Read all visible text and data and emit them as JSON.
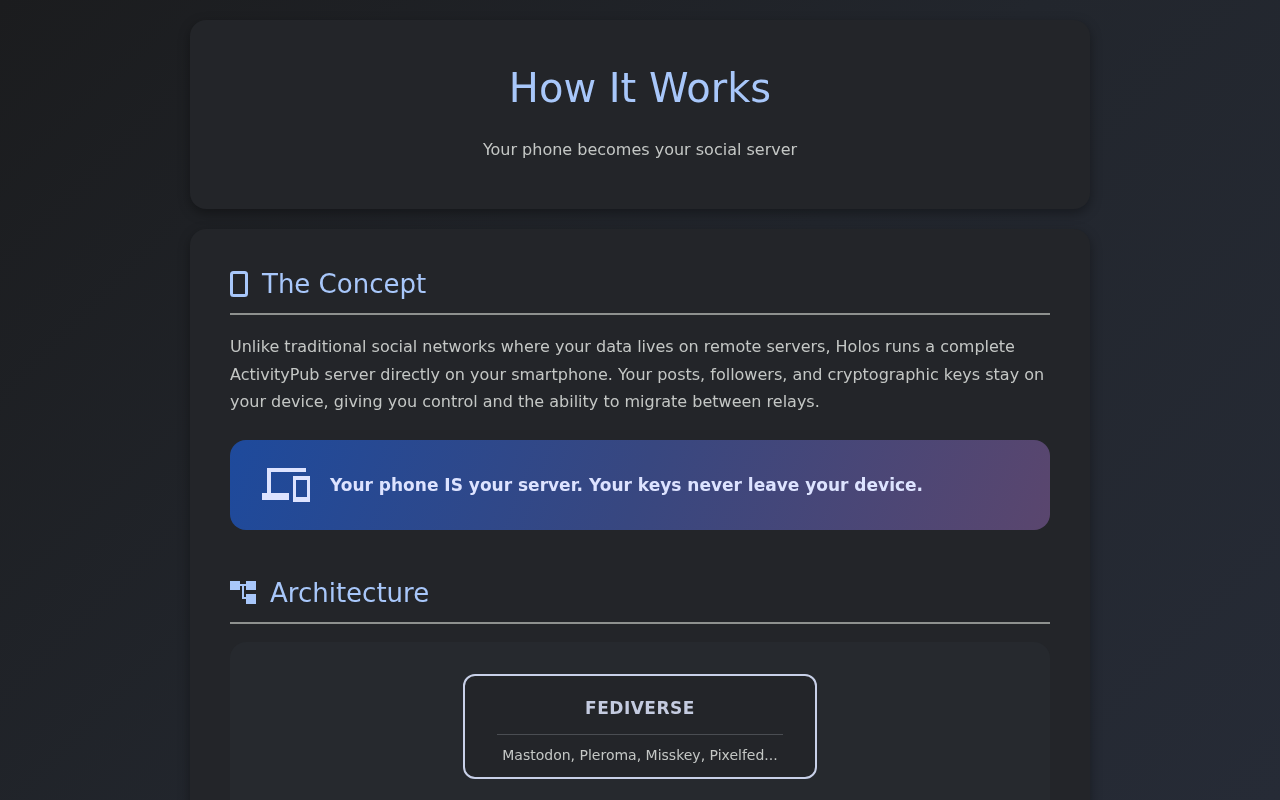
{
  "header": {
    "title": "How It Works",
    "subtitle": "Your phone becomes your social server"
  },
  "sections": [
    {
      "kind": "concept",
      "heading": "The Concept",
      "paragraph": "Unlike traditional social networks where your data lives on remote servers, Holos runs a complete ActivityPub server directly on your smartphone. Your posts, followers, and cryptographic keys stay on your device, giving you control and the ability to migrate between relays.",
      "callout": "Your phone IS your server. Your keys never leave your device."
    },
    {
      "kind": "architecture",
      "heading": "Architecture",
      "nodes": [
        {
          "title": "FEDIVERSE",
          "description": "Mastodon, Pleroma, Misskey, Pixelfed..."
        }
      ]
    }
  ]
}
